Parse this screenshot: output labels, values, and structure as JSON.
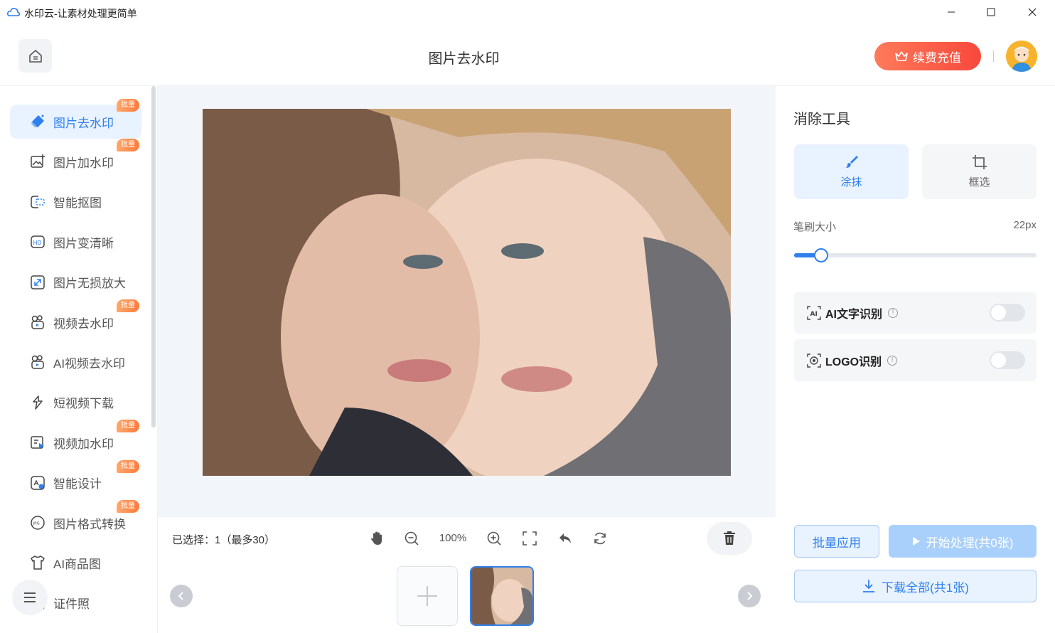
{
  "window": {
    "title": "水印云-让素材处理更简单"
  },
  "header": {
    "page_title": "图片去水印",
    "recharge_label": "续费充值"
  },
  "sidebar": {
    "items": [
      {
        "label": "图片去水印",
        "icon": "eraser-icon",
        "badge": "批量",
        "active": true
      },
      {
        "label": "图片加水印",
        "icon": "image-add-icon",
        "badge": "批量"
      },
      {
        "label": "智能抠图",
        "icon": "cutout-icon"
      },
      {
        "label": "图片变清晰",
        "icon": "hd-icon"
      },
      {
        "label": "图片无损放大",
        "icon": "enlarge-icon"
      },
      {
        "label": "视频去水印",
        "icon": "video-clean-icon",
        "badge": "批量"
      },
      {
        "label": "AI视频去水印",
        "icon": "ai-video-clean-icon"
      },
      {
        "label": "短视频下载",
        "icon": "download-link-icon"
      },
      {
        "label": "视频加水印",
        "icon": "video-add-icon",
        "badge": "批量"
      },
      {
        "label": "智能设计",
        "icon": "design-icon",
        "badge": "批量"
      },
      {
        "label": "图片格式转换",
        "icon": "jpg-icon",
        "badge": "批量"
      },
      {
        "label": "AI商品图",
        "icon": "shirt-icon"
      },
      {
        "label": "证件照",
        "icon": "id-photo-icon"
      }
    ]
  },
  "toolbar": {
    "selected_text": "已选择：1（最多30）",
    "zoom": "100%"
  },
  "panel": {
    "title": "消除工具",
    "modes": [
      {
        "label": "涂抹",
        "active": true
      },
      {
        "label": "框选",
        "active": false
      }
    ],
    "brush_label": "笔刷大小",
    "brush_value": "22px",
    "brush_level": 0.11,
    "options": [
      {
        "label": "AI文字识别",
        "enabled": false
      },
      {
        "label": "LOGO识别",
        "enabled": false
      }
    ],
    "batch_label": "批量应用",
    "start_label": "开始处理(共0张)",
    "download_label": "下载全部(共1张)"
  },
  "colors": {
    "accent": "#2f80ed",
    "recharge": "#f8483c",
    "badge": "#ff7a3c"
  }
}
